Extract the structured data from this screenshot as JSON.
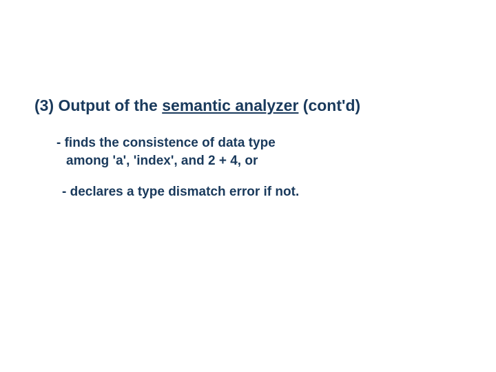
{
  "heading": {
    "prefix": "(3) Output of the ",
    "underlined": "semantic analyzer",
    "suffix": " (cont'd)"
  },
  "bullet1": {
    "line1": "- finds the consistence of data type",
    "line2": "among 'a', 'index', and 2 + 4, or"
  },
  "bullet2": "- declares a type dismatch error if not."
}
